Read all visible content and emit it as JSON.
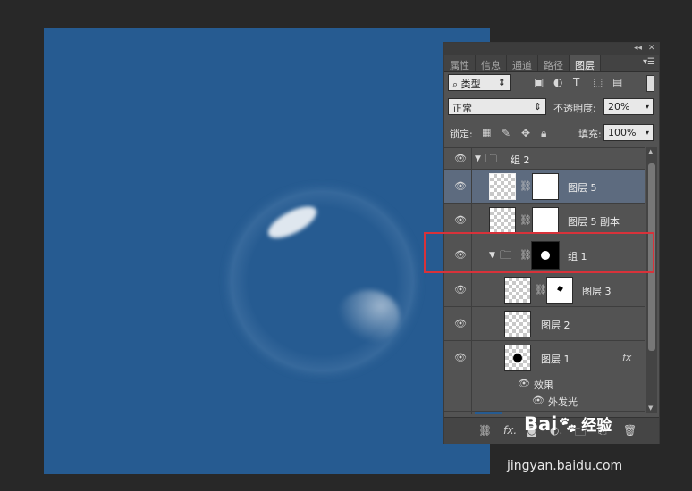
{
  "panel": {
    "tabs": [
      "属性",
      "信息",
      "通道",
      "路径",
      "图层"
    ],
    "active_tab": "图层",
    "filter": {
      "kind_label": "类型"
    },
    "blend_mode": "正常",
    "opacity_label": "不透明度:",
    "opacity_value": "20%",
    "lock_label": "锁定:",
    "fill_label": "填充:",
    "fill_value": "100%",
    "layers": [
      {
        "name": "组 2",
        "type": "group",
        "expanded": true
      },
      {
        "name": "图层 5",
        "selected": true
      },
      {
        "name": "图层 5 副本"
      },
      {
        "name": "组 1",
        "type": "group",
        "expanded": true
      },
      {
        "name": "图层 3"
      },
      {
        "name": "图层 2"
      },
      {
        "name": "图层 1",
        "fx": "fx"
      }
    ],
    "effects_label": "效果",
    "outer_glow_label": "外发光"
  },
  "watermark": {
    "logo": "Bai",
    "logo_tail": "经验",
    "url": "jingyan.baidu.com"
  },
  "colors": {
    "canvas_bg": "#265b91",
    "highlight_box": "#d8323a",
    "selected_layer": "#5d6b7f"
  }
}
